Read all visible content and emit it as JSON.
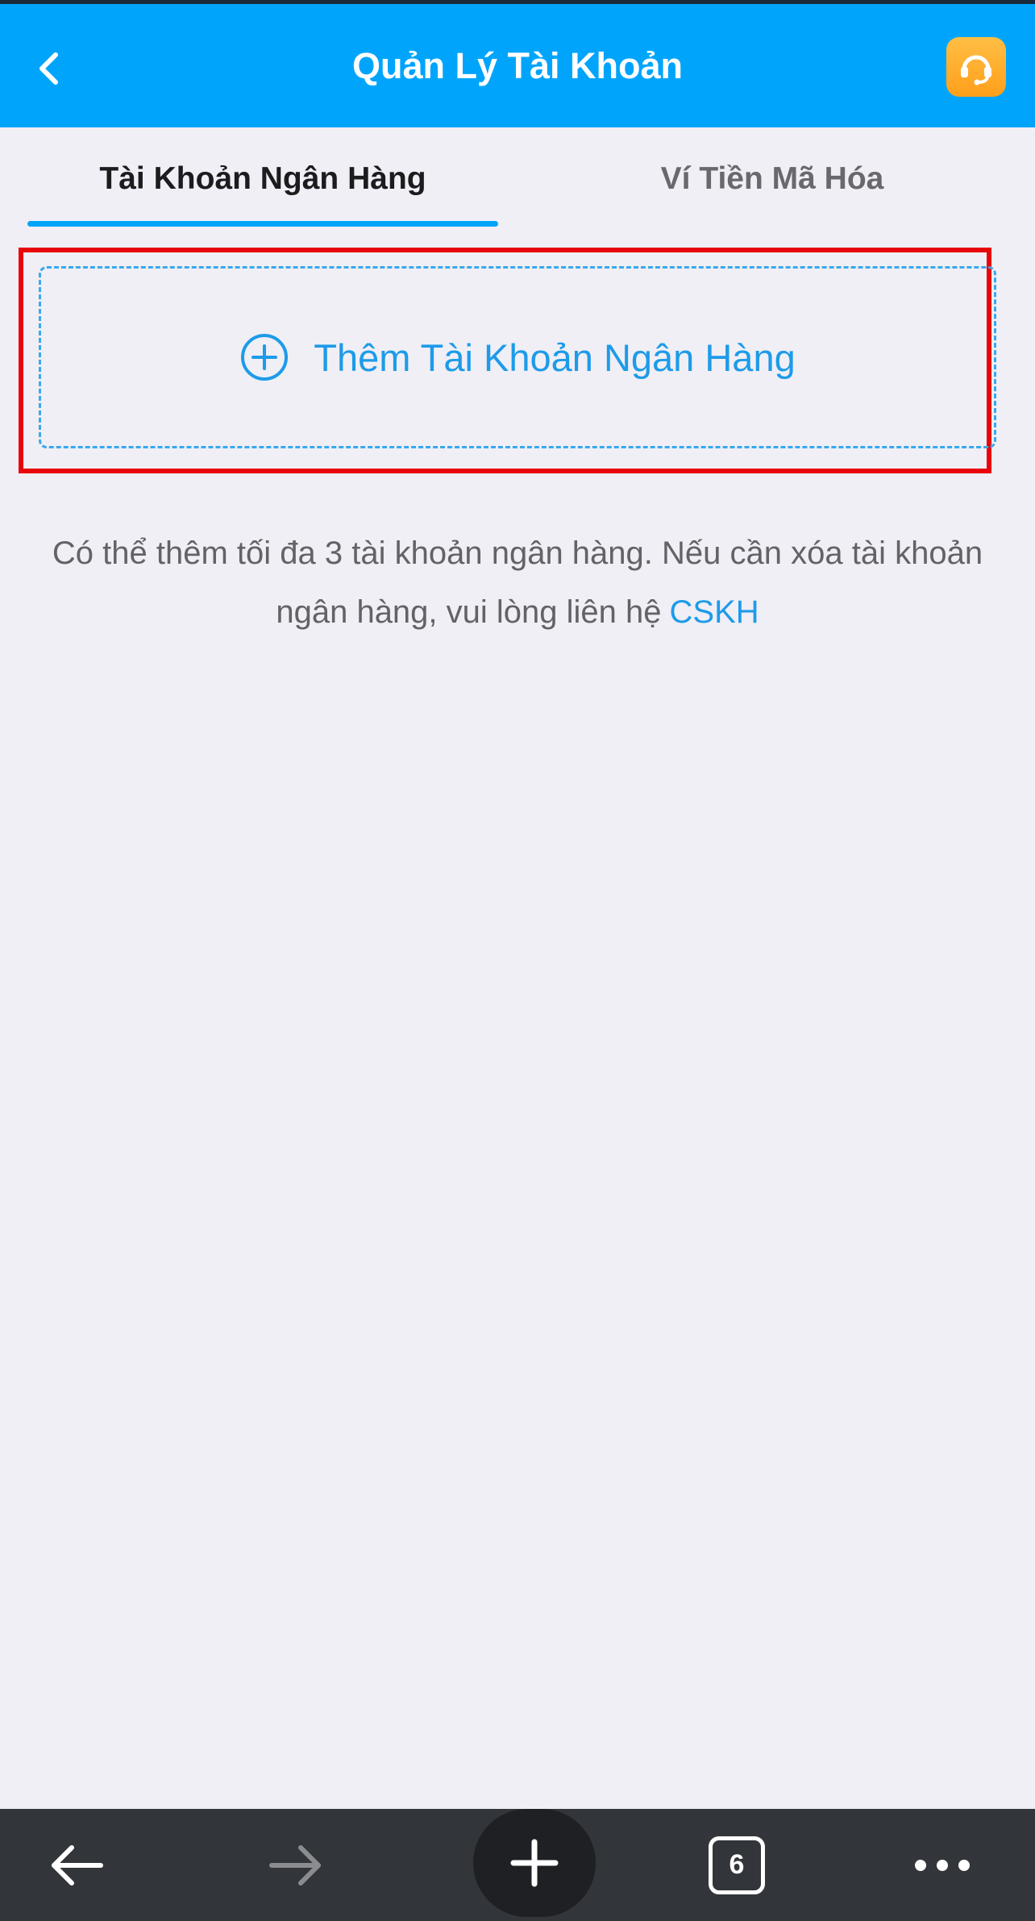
{
  "header": {
    "title": "Quản Lý Tài Khoản",
    "back_icon": "chevron-left-icon",
    "support_icon": "headset-icon"
  },
  "tabs": [
    {
      "label": "Tài Khoản Ngân Hàng",
      "active": true
    },
    {
      "label": "Ví Tiền Mã Hóa",
      "active": false
    }
  ],
  "add_bank": {
    "label": "Thêm Tài Khoản Ngân Hàng",
    "icon": "plus-circle-icon"
  },
  "info": {
    "text": "Có thể thêm tối đa 3 tài khoản ngân hàng. Nếu cần xóa tài khoản ngân hàng, vui lòng liên hệ",
    "link_label": "CSKH"
  },
  "browser_bar": {
    "tab_count": "6",
    "icons": [
      "arrow-left-icon",
      "arrow-right-icon",
      "plus-icon",
      "tabs-icon",
      "more-icon"
    ]
  },
  "colors": {
    "header_blue": "#00a5fb",
    "accent_blue": "#1d9be9",
    "highlight_red": "#e8050c",
    "support_orange": "#ffa826",
    "background": "#f0eff5",
    "bottom_bar": "#323539"
  }
}
